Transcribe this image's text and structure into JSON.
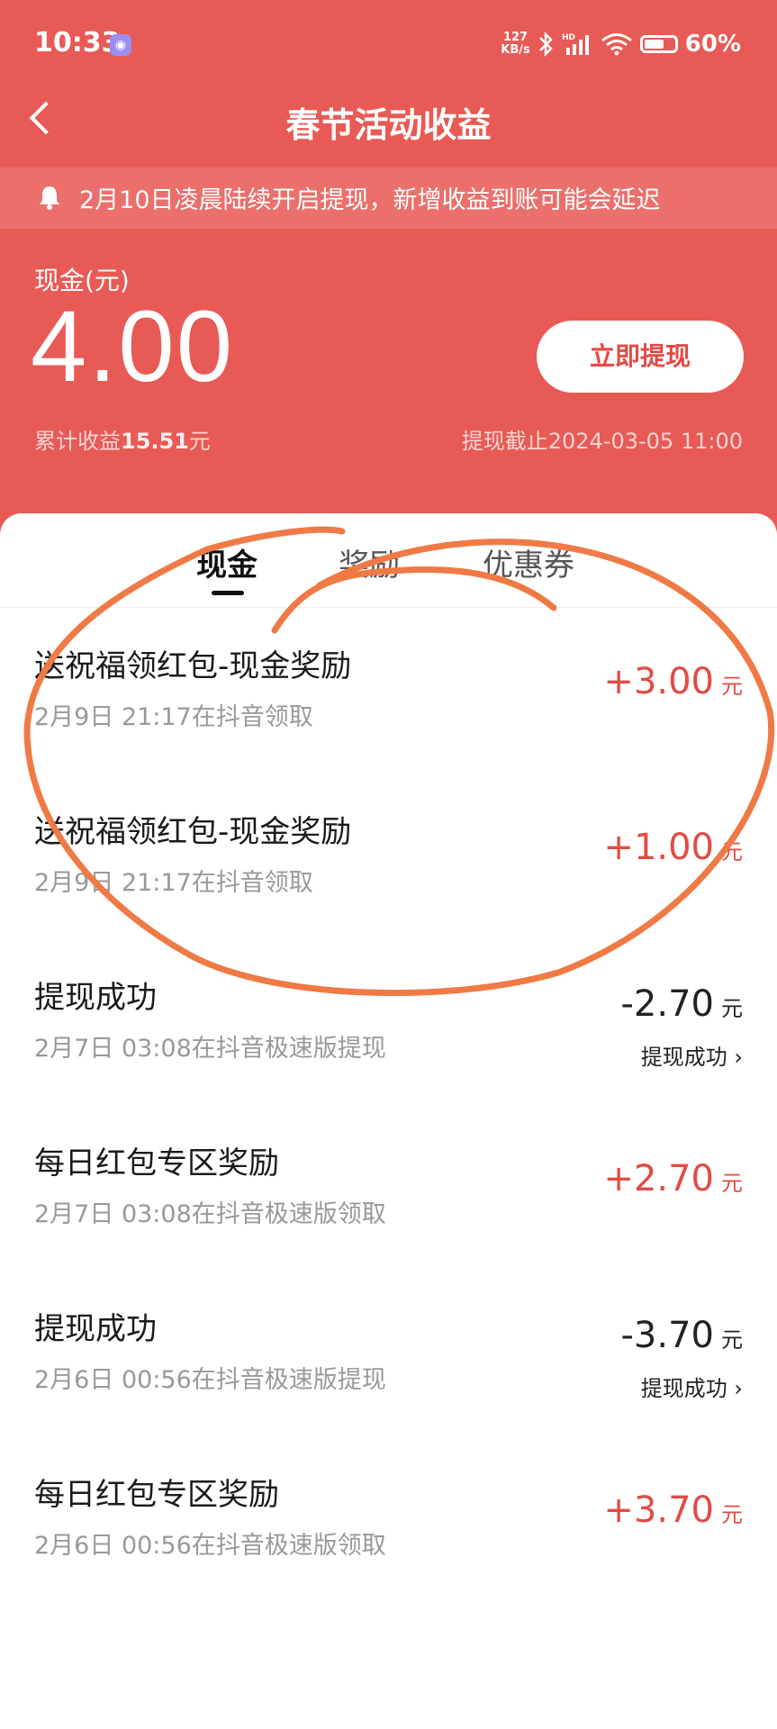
{
  "status_bar": {
    "time": "10:33",
    "net_speed_value": "127",
    "net_speed_unit": "KB/s",
    "network": "HD",
    "battery": "60%"
  },
  "header": {
    "title": "春节活动收益"
  },
  "notice": {
    "text": "2月10日凌晨陆续开启提现，新增收益到账可能会延迟"
  },
  "balance": {
    "label": "现金(元)",
    "amount": "4.00",
    "withdraw_label": "立即提现",
    "total_prefix": "累计收益",
    "total_value": "15.51",
    "total_suffix": "元",
    "deadline": "提现截止2024-03-05 11:00"
  },
  "tabs": [
    {
      "label": "现金",
      "active": true
    },
    {
      "label": "奖励",
      "active": false
    },
    {
      "label": "优惠券",
      "active": false
    }
  ],
  "transactions": [
    {
      "title": "送祝福领红包-现金奖励",
      "subtitle": "2月9日 21:17在抖音领取",
      "amount": "+3.00",
      "unit": "元",
      "status": ""
    },
    {
      "title": "送祝福领红包-现金奖励",
      "subtitle": "2月9日 21:17在抖音领取",
      "amount": "+1.00",
      "unit": "元",
      "status": ""
    },
    {
      "title": "提现成功",
      "subtitle": "2月7日 03:08在抖音极速版提现",
      "amount": "-2.70",
      "unit": "元",
      "status": "提现成功"
    },
    {
      "title": "每日红包专区奖励",
      "subtitle": "2月7日 03:08在抖音极速版领取",
      "amount": "+2.70",
      "unit": "元",
      "status": ""
    },
    {
      "title": "提现成功",
      "subtitle": "2月6日 00:56在抖音极速版提现",
      "amount": "-3.70",
      "unit": "元",
      "status": "提现成功"
    },
    {
      "title": "每日红包专区奖励",
      "subtitle": "2月6日 00:56在抖音极速版领取",
      "amount": "+3.70",
      "unit": "元",
      "status": ""
    }
  ],
  "colors": {
    "header_red": "#e85a55",
    "positive_amount": "#e14b45",
    "annotation_orange": "#ef7a45"
  }
}
